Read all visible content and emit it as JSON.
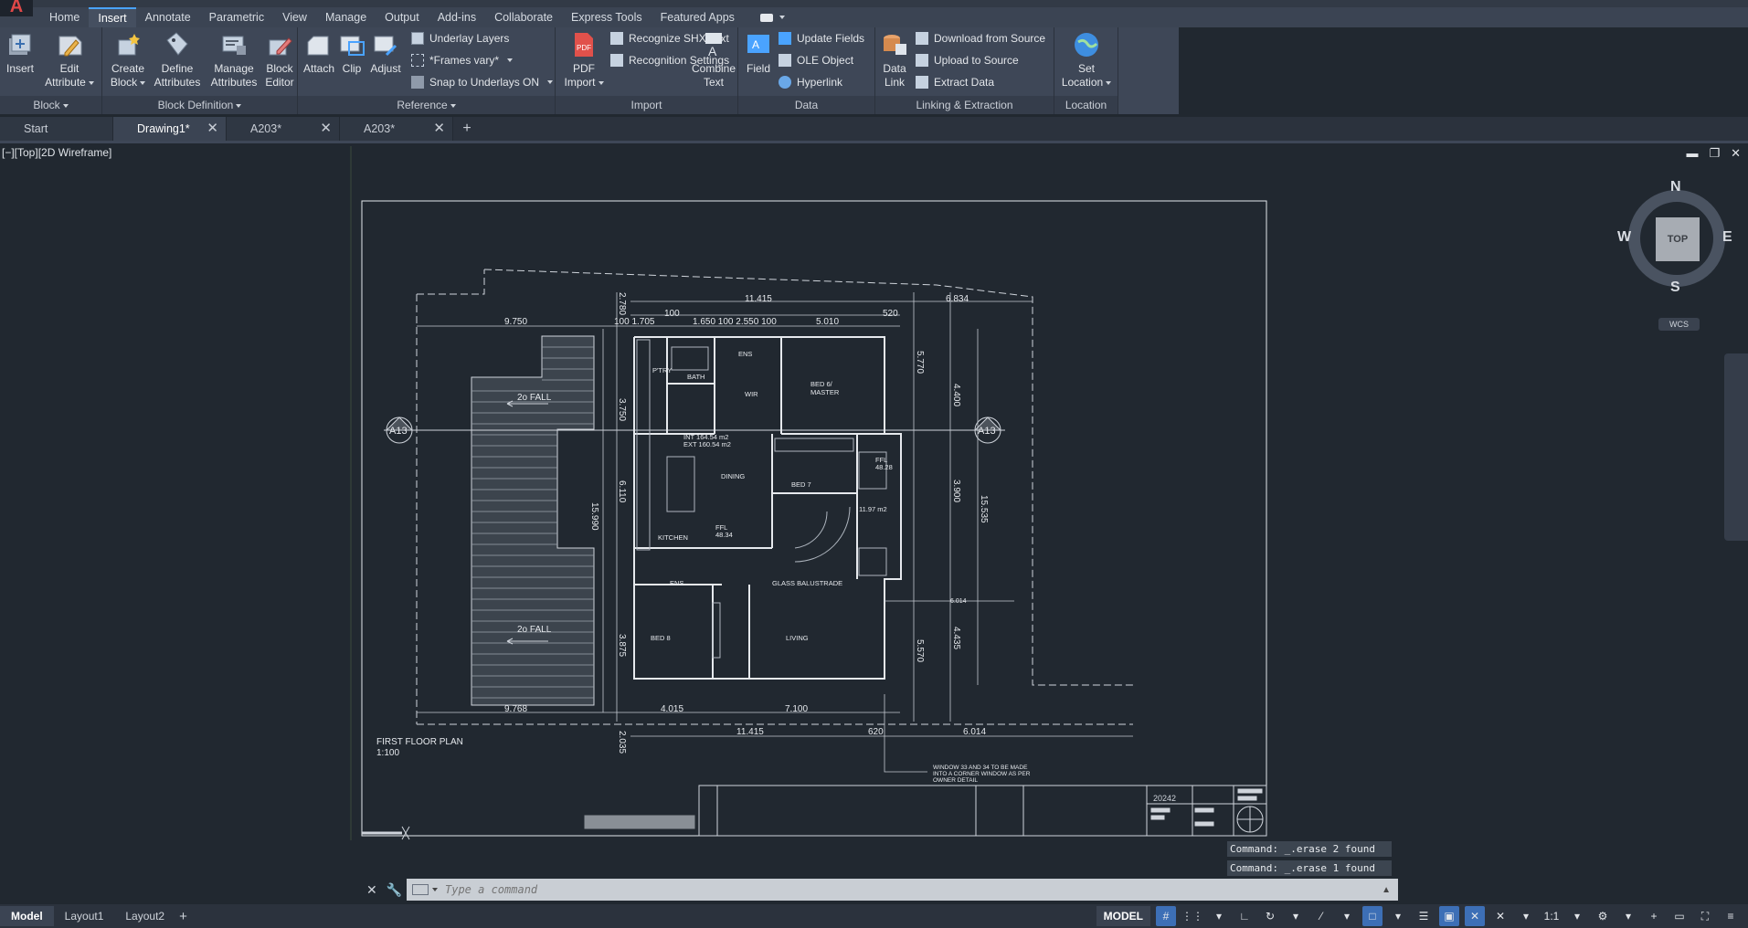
{
  "app": {
    "logo": "A"
  },
  "ribbon_tabs": [
    {
      "label": "Home"
    },
    {
      "label": "Insert"
    },
    {
      "label": "Annotate"
    },
    {
      "label": "Parametric"
    },
    {
      "label": "View"
    },
    {
      "label": "Manage"
    },
    {
      "label": "Output"
    },
    {
      "label": "Add-ins"
    },
    {
      "label": "Collaborate"
    },
    {
      "label": "Express Tools"
    },
    {
      "label": "Featured Apps"
    }
  ],
  "active_tab": "Insert",
  "ribbon": {
    "block": {
      "title": "Block",
      "insert": "Insert",
      "edit_attribute_1": "Edit",
      "edit_attribute_2": "Attribute"
    },
    "block_definition": {
      "title": "Block Definition",
      "create_1": "Create",
      "create_2": "Block",
      "define_1": "Define",
      "define_2": "Attributes",
      "manage_1": "Manage",
      "manage_2": "Attributes",
      "editor_1": "Block",
      "editor_2": "Editor"
    },
    "reference": {
      "title": "Reference",
      "attach": "Attach",
      "clip": "Clip",
      "adjust": "Adjust",
      "underlay_layers": "Underlay Layers",
      "frames_vary": "*Frames vary*",
      "snap_underlays": "Snap to Underlays ON"
    },
    "import": {
      "title": "Import",
      "pdf_1": "PDF",
      "pdf_2": "Import",
      "recognize_shx": "Recognize SHX Text",
      "recognition_settings": "Recognition Settings",
      "combine_1": "Combine",
      "combine_2": "Text"
    },
    "data": {
      "title": "Data",
      "field": "Field",
      "update_fields": "Update Fields",
      "ole_object": "OLE Object",
      "hyperlink": "Hyperlink"
    },
    "linking": {
      "title": "Linking & Extraction",
      "data_link_1": "Data",
      "data_link_2": "Link",
      "download": "Download from Source",
      "upload": "Upload to Source",
      "extract": "Extract  Data"
    },
    "location": {
      "title": "Location",
      "set_1": "Set",
      "set_2": "Location"
    }
  },
  "doc_tabs": [
    {
      "label": "Start"
    },
    {
      "label": "Drawing1*"
    },
    {
      "label": "A203*"
    },
    {
      "label": "A203*"
    }
  ],
  "viewport": {
    "label": "[−][Top][2D Wireframe]"
  },
  "viewcube": {
    "top": "TOP",
    "n": "N",
    "s": "S",
    "e": "E",
    "w": "W",
    "wcs": "WCS"
  },
  "drawing": {
    "title": "FIRST FLOOR PLAN",
    "scale": "1:100",
    "section_mark": "A13",
    "rooms": {
      "bath": "BATH",
      "pantry": "P'TRY",
      "ens": "ENS",
      "wir": "WIR",
      "master_1": "BED 6/",
      "master_2": "MASTER",
      "dining": "DINING",
      "bed7": "BED 7",
      "kitchen": "KITCHEN",
      "bed8": "BED 8",
      "living": "LIVING",
      "balustrade": "GLASS BALUSTRADE",
      "ens2": "ENS",
      "area1": "INT 164.54 m2",
      "area2": "EXT 160.54 m2",
      "ffl1": "FFL",
      "ffl1_val": "48.34",
      "ffl2": "FFL",
      "ffl2_val": "48.28",
      "void": "11.97 m2"
    },
    "fall_1": "2o FALL",
    "fall_2": "2o FALL",
    "note_1": "WINDOW 33 AND 34 TO BE MADE",
    "note_2": "INTO A CORNER WINDOW AS PER",
    "note_3": "OWNER DETAIL",
    "titleblock_no": "20242",
    "dims": {
      "top_total": "11.415",
      "top_right": "6.834",
      "top_100": "100",
      "top_520": "520",
      "left_9750": "9.750",
      "seg_1705": "100  1.705",
      "seg_1650": "1.650 100 2.550 100",
      "seg_5010": "5.010",
      "bottom_9768": "9.768",
      "bottom_4015": "4.015",
      "bottom_7100": "7.100",
      "bottom_total": "11.415",
      "bottom_620": "620",
      "bottom_6014": "6.014",
      "left_3750": "3.750",
      "left_6110": "6.110",
      "left_15990": "15.990",
      "left_3875": "3.875",
      "left_2780": "2.780",
      "left_2035": "2.035",
      "right_5770": "5.770",
      "right_4400": "4.400",
      "right_3900": "3.900",
      "right_15535": "15.535",
      "right_4435": "4.435",
      "right_5570": "5.570",
      "right_6014": "6.014"
    }
  },
  "command": {
    "history": [
      "Command: _.erase 2 found",
      "Command: _.erase 1 found"
    ],
    "placeholder": "Type a command"
  },
  "status": {
    "layouts": [
      {
        "label": "Model"
      },
      {
        "label": "Layout1"
      },
      {
        "label": "Layout2"
      }
    ],
    "model": "MODEL",
    "scale": "1:1"
  },
  "colors": {
    "accent": "#4aa3ff",
    "background": "#212830",
    "ribbon": "#3e4757"
  }
}
